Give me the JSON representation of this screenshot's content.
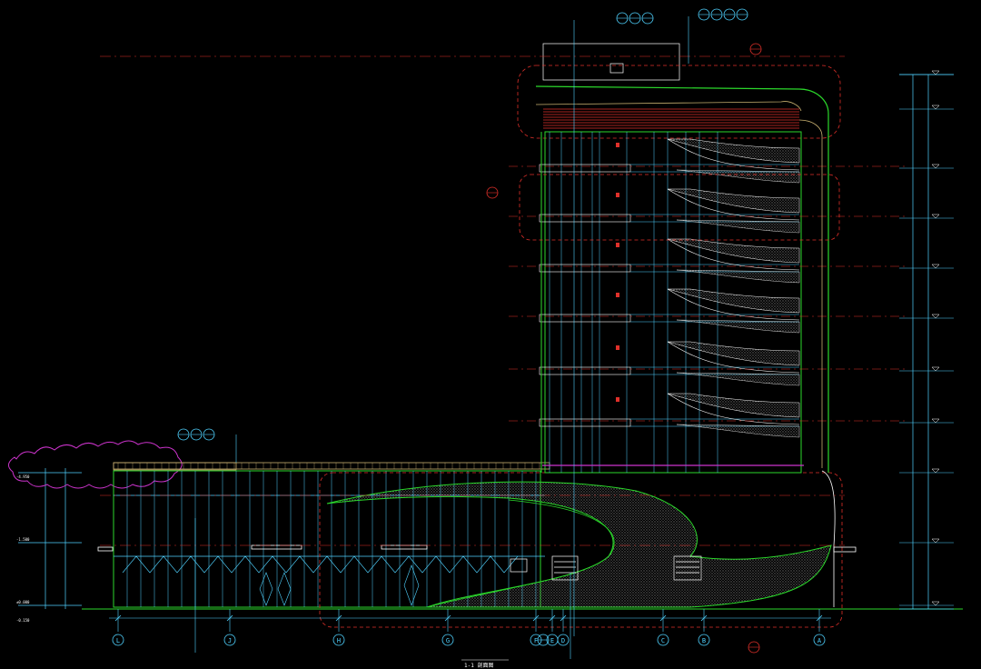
{
  "drawing": {
    "title": "1-1 剖面图",
    "grid_labels": [
      "L",
      "J",
      "H",
      "G",
      "F",
      "E",
      "D",
      "C",
      "B",
      "A"
    ],
    "detail_bubble_labels": [
      "1",
      "2",
      "3",
      "4",
      "5"
    ],
    "colors": {
      "background": "#000000",
      "cyan": "#4fd2ff",
      "green": "#2bd82b",
      "red": "#e0302a",
      "magenta": "#cc33cc",
      "white": "#ffffff",
      "tan": "#c8b070",
      "blue": "#3a5fff"
    }
  }
}
